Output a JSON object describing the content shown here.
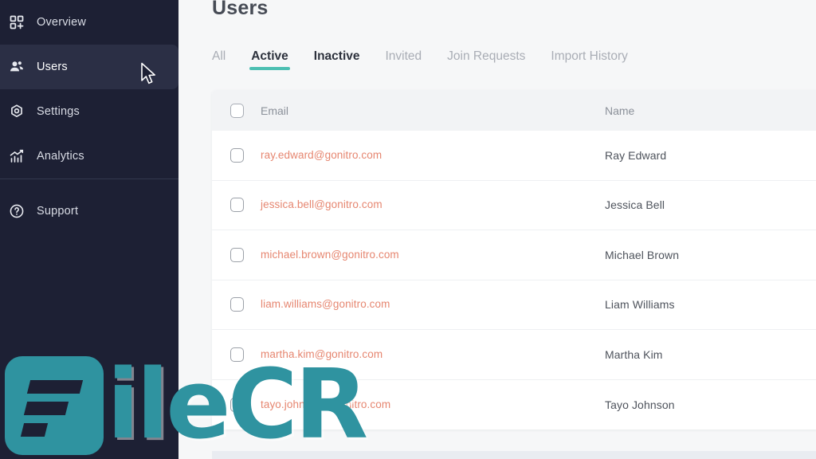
{
  "sidebar": {
    "items": [
      {
        "label": "Overview",
        "icon": "grid-plus-icon",
        "active": false
      },
      {
        "label": "Users",
        "icon": "users-icon",
        "active": true
      },
      {
        "label": "Settings",
        "icon": "gear-icon",
        "active": false
      },
      {
        "label": "Analytics",
        "icon": "chart-icon",
        "active": false
      }
    ],
    "support": {
      "label": "Support",
      "icon": "help-circle-icon"
    },
    "background_color": "#1d2034",
    "active_background_color": "#2b2f45"
  },
  "main": {
    "page_title": "Users",
    "tabs": [
      {
        "label": "All",
        "state": "inactive"
      },
      {
        "label": "Active",
        "state": "selected"
      },
      {
        "label": "Inactive",
        "state": "strong"
      },
      {
        "label": "Invited",
        "state": "inactive"
      },
      {
        "label": "Join Requests",
        "state": "inactive"
      },
      {
        "label": "Import History",
        "state": "inactive"
      }
    ],
    "tab_accent_color": "#4cbfb2",
    "table": {
      "columns": [
        "Email",
        "Name"
      ],
      "select_all_checked": false,
      "email_link_color": "#e68670",
      "rows": [
        {
          "email": "ray.edward@gonitro.com",
          "name": "Ray Edward",
          "checked": false
        },
        {
          "email": "jessica.bell@gonitro.com",
          "name": "Jessica Bell",
          "checked": false
        },
        {
          "email": "michael.brown@gonitro.com",
          "name": "Michael Brown",
          "checked": false
        },
        {
          "email": "liam.williams@gonitro.com",
          "name": "Liam Williams",
          "checked": false
        },
        {
          "email": "martha.kim@gonitro.com",
          "name": "Martha Kim",
          "checked": false
        },
        {
          "email": "tayo.johnson@gonitro.com",
          "name": "Tayo Johnson",
          "checked": false
        }
      ]
    }
  },
  "watermark": {
    "text": "ileCR",
    "color": "#2f93a0"
  }
}
